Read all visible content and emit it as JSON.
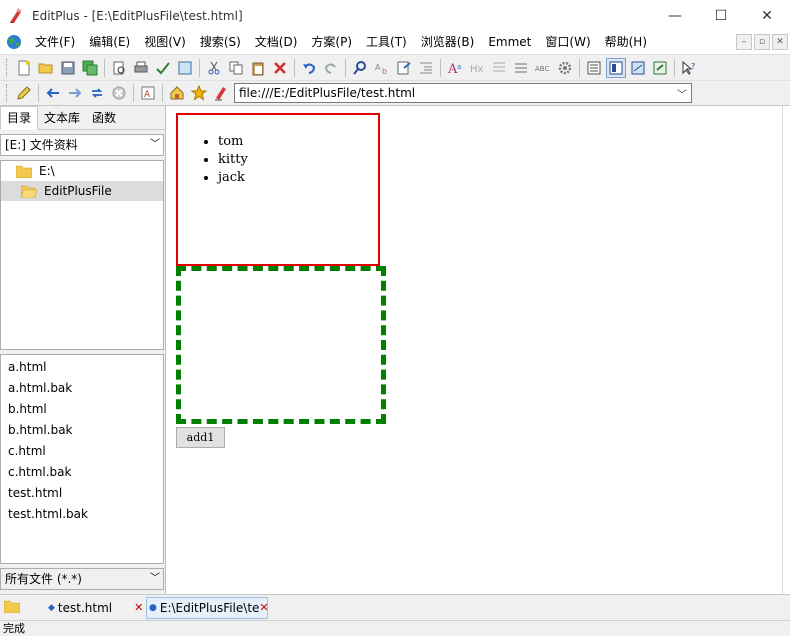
{
  "window": {
    "title": "EditPlus - [E:\\EditPlusFile\\test.html]",
    "minimize": "—",
    "maximize": "☐",
    "close": "✕"
  },
  "menu": {
    "items": [
      "文件(F)",
      "编辑(E)",
      "视图(V)",
      "搜索(S)",
      "文档(D)",
      "方案(P)",
      "工具(T)",
      "浏览器(B)",
      "Emmet",
      "窗口(W)",
      "帮助(H)"
    ]
  },
  "address": {
    "url": "file:///E:/EditPlusFile/test.html"
  },
  "left_panel": {
    "tabs": [
      "目录",
      "文本库",
      "函数"
    ],
    "active_tab": 0,
    "drive": "[E:] 文件资料",
    "tree": [
      {
        "label": "E:\\",
        "selected": false
      },
      {
        "label": "EditPlusFile",
        "selected": true
      }
    ],
    "files": [
      "a.html",
      "a.html.bak",
      "b.html",
      "b.html.bak",
      "c.html",
      "c.html.bak",
      "test.html",
      "test.html.bak"
    ],
    "filter": "所有文件 (*.*)"
  },
  "preview": {
    "list_items": [
      "tom",
      "kitty",
      "jack"
    ],
    "button_label": "add1"
  },
  "doc_tabs": [
    {
      "label": "test.html",
      "active": false
    },
    {
      "label": "E:\\EditPlusFile\\te",
      "active": true
    }
  ],
  "status": {
    "text": "完成"
  },
  "colors": {
    "red_border": "#e00000",
    "green_border": "#008000"
  }
}
